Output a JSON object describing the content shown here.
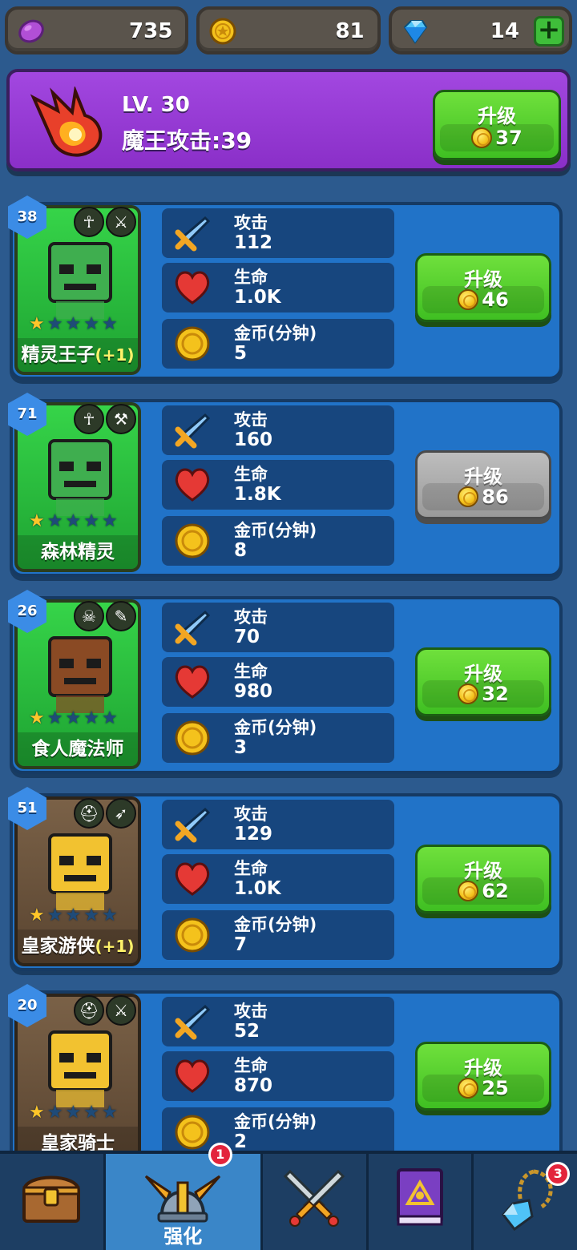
{
  "currency": {
    "elixir": "735",
    "gold": "81",
    "gems": "14"
  },
  "boss": {
    "level": "LV. 30",
    "attack_text": "魔王攻击:39",
    "upgrade_label": "升级",
    "upgrade_cost": "37"
  },
  "heroes": [
    {
      "level": "38",
      "name": "精灵王子",
      "bonus": "(+1)",
      "stars": 1,
      "portrait": "green",
      "stats": {
        "attack_label": "攻击",
        "attack": "112",
        "hp_label": "生命",
        "hp": "1.0K",
        "gold_label": "金币(分钟)",
        "gold": "5"
      },
      "upgrade_label": "升级",
      "upgrade_cost": "46",
      "upgrade_enabled": true
    },
    {
      "level": "71",
      "name": "森林精灵",
      "bonus": "",
      "stars": 1,
      "portrait": "green",
      "stats": {
        "attack_label": "攻击",
        "attack": "160",
        "hp_label": "生命",
        "hp": "1.8K",
        "gold_label": "金币(分钟)",
        "gold": "8"
      },
      "upgrade_label": "升级",
      "upgrade_cost": "86",
      "upgrade_enabled": false
    },
    {
      "level": "26",
      "name": "食人魔法师",
      "bonus": "",
      "stars": 1,
      "portrait": "green",
      "stats": {
        "attack_label": "攻击",
        "attack": "70",
        "hp_label": "生命",
        "hp": "980",
        "gold_label": "金币(分钟)",
        "gold": "3"
      },
      "upgrade_label": "升级",
      "upgrade_cost": "32",
      "upgrade_enabled": true
    },
    {
      "level": "51",
      "name": "皇家游侠",
      "bonus": "(+1)",
      "stars": 1,
      "portrait": "brown",
      "stats": {
        "attack_label": "攻击",
        "attack": "129",
        "hp_label": "生命",
        "hp": "1.0K",
        "gold_label": "金币(分钟)",
        "gold": "7"
      },
      "upgrade_label": "升级",
      "upgrade_cost": "62",
      "upgrade_enabled": true
    },
    {
      "level": "20",
      "name": "皇家骑士",
      "bonus": "",
      "stars": 1,
      "portrait": "brown",
      "stats": {
        "attack_label": "攻击",
        "attack": "52",
        "hp_label": "生命",
        "hp": "870",
        "gold_label": "金币(分钟)",
        "gold": "2"
      },
      "upgrade_label": "升级",
      "upgrade_cost": "25",
      "upgrade_enabled": true
    }
  ],
  "nav": {
    "tabs": [
      {
        "name": "chest",
        "label": ""
      },
      {
        "name": "upgrade",
        "label": "强化",
        "badge": "1",
        "active": true
      },
      {
        "name": "battle",
        "label": ""
      },
      {
        "name": "spellbook",
        "label": ""
      },
      {
        "name": "amulet",
        "label": "",
        "badge": "3"
      }
    ]
  }
}
